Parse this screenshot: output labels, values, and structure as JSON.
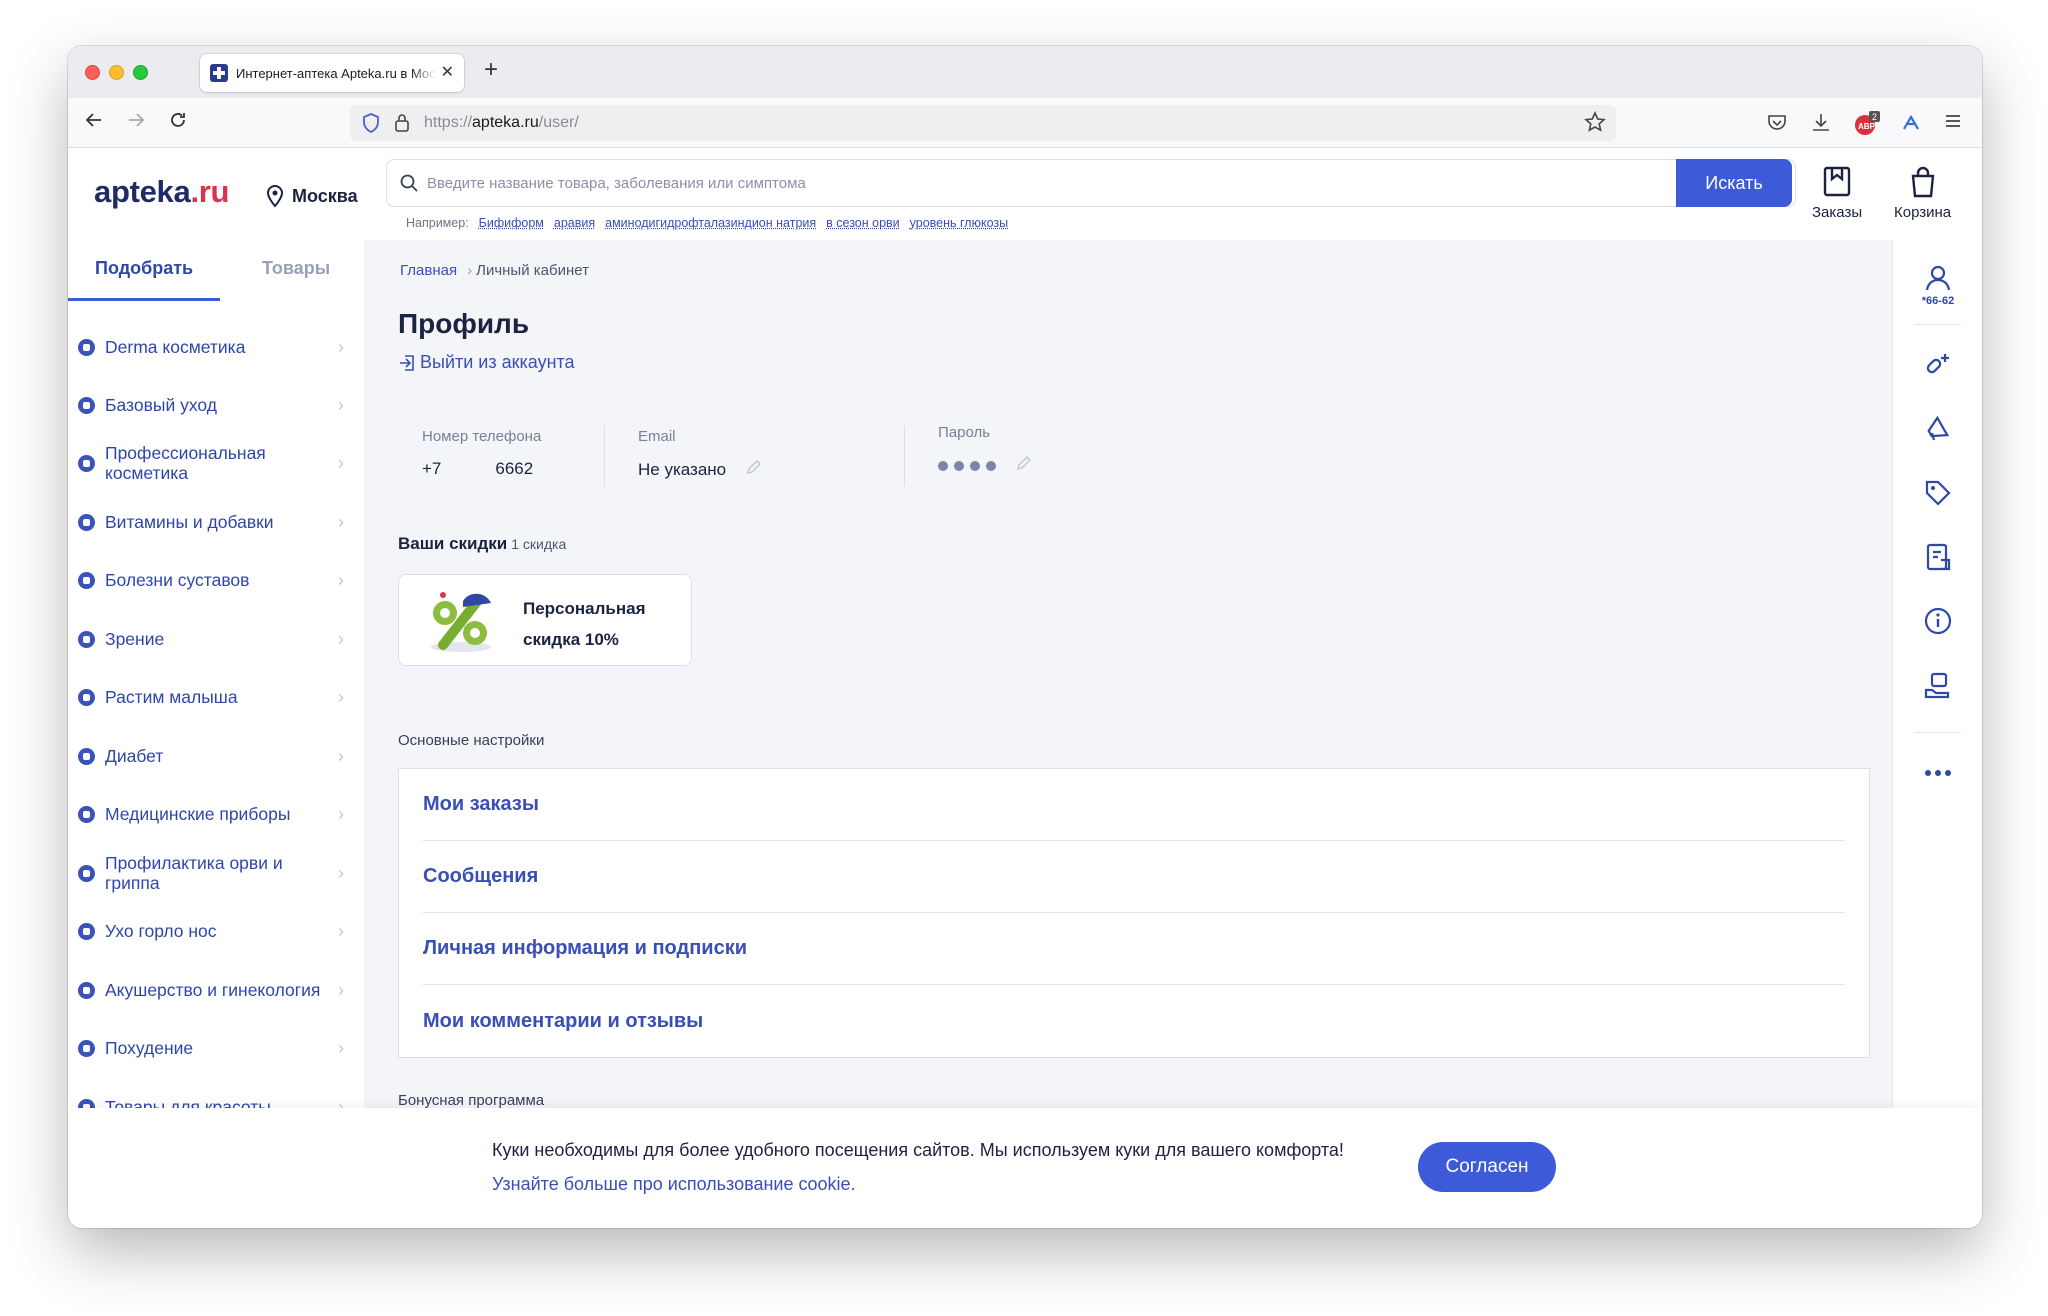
{
  "browser": {
    "tab_title": "Интернет-аптека Apteka.ru в Москве",
    "tab_close": "✕",
    "new_tab": "+",
    "url_scheme": "https://",
    "url_host": "apteka.ru",
    "url_path": "/user/",
    "adblock_badge": "2"
  },
  "header": {
    "logo_main": "apteka",
    "logo_tld": ".ru",
    "city": "Москва",
    "search_placeholder": "Введите название товара, заболевания или симптома",
    "search_button": "Искать",
    "examples_label": "Например:",
    "examples": [
      "Бифиформ",
      "аравия",
      "аминодигидрофталазиндион натрия",
      "в сезон орви",
      "уровень глюкозы"
    ],
    "orders_label": "Заказы",
    "cart_label": "Корзина"
  },
  "sidebar": {
    "tab_active": "Подобрать",
    "tab_inactive": "Товары",
    "items": [
      {
        "label": "Derma косметика"
      },
      {
        "label": "Базовый уход"
      },
      {
        "label": "Профессиональная косметика"
      },
      {
        "label": "Витамины и добавки"
      },
      {
        "label": "Болезни суставов"
      },
      {
        "label": "Зрение"
      },
      {
        "label": "Растим малыша"
      },
      {
        "label": "Диабет"
      },
      {
        "label": "Медицинские приборы"
      },
      {
        "label": "Профилактика орви и гриппа"
      },
      {
        "label": "Ухо горло нос"
      },
      {
        "label": "Акушерство и гинекология"
      },
      {
        "label": "Похудение"
      },
      {
        "label": "Товары для красоты"
      }
    ]
  },
  "main": {
    "breadcrumb_home": "Главная",
    "breadcrumb_sep": "›",
    "breadcrumb_current": "Личный кабинет",
    "title": "Профиль",
    "logout": "Выйти из аккаунта",
    "phone_label": "Номер телефона",
    "phone_prefix": "+7",
    "phone_suffix": "6662",
    "email_label": "Email",
    "email_value": "Не указано",
    "password_label": "Пароль",
    "discounts_title": "Ваши скидки",
    "discounts_count": "1 скидка",
    "discount_card": "Персональная скидка 10%",
    "settings_title": "Основные настройки",
    "settings": [
      {
        "label": "Мои заказы"
      },
      {
        "label": "Сообщения"
      },
      {
        "label": "Личная информация и подписки"
      },
      {
        "label": "Мои комментарии и отзывы"
      }
    ],
    "bonus_title": "Бонусная программа"
  },
  "rail": {
    "phone_tail": "*66-62"
  },
  "cookie": {
    "text": "Куки необходимы для более удобного посещения сайтов. Мы используем куки для вашего комфорта!",
    "link": "Узнайте больше про использование cookie.",
    "button": "Согласен"
  },
  "colors": {
    "accent": "#3d5bd9",
    "link": "#3a4eb8",
    "logo_red": "#e1304e",
    "text_dark": "#1c2242"
  }
}
